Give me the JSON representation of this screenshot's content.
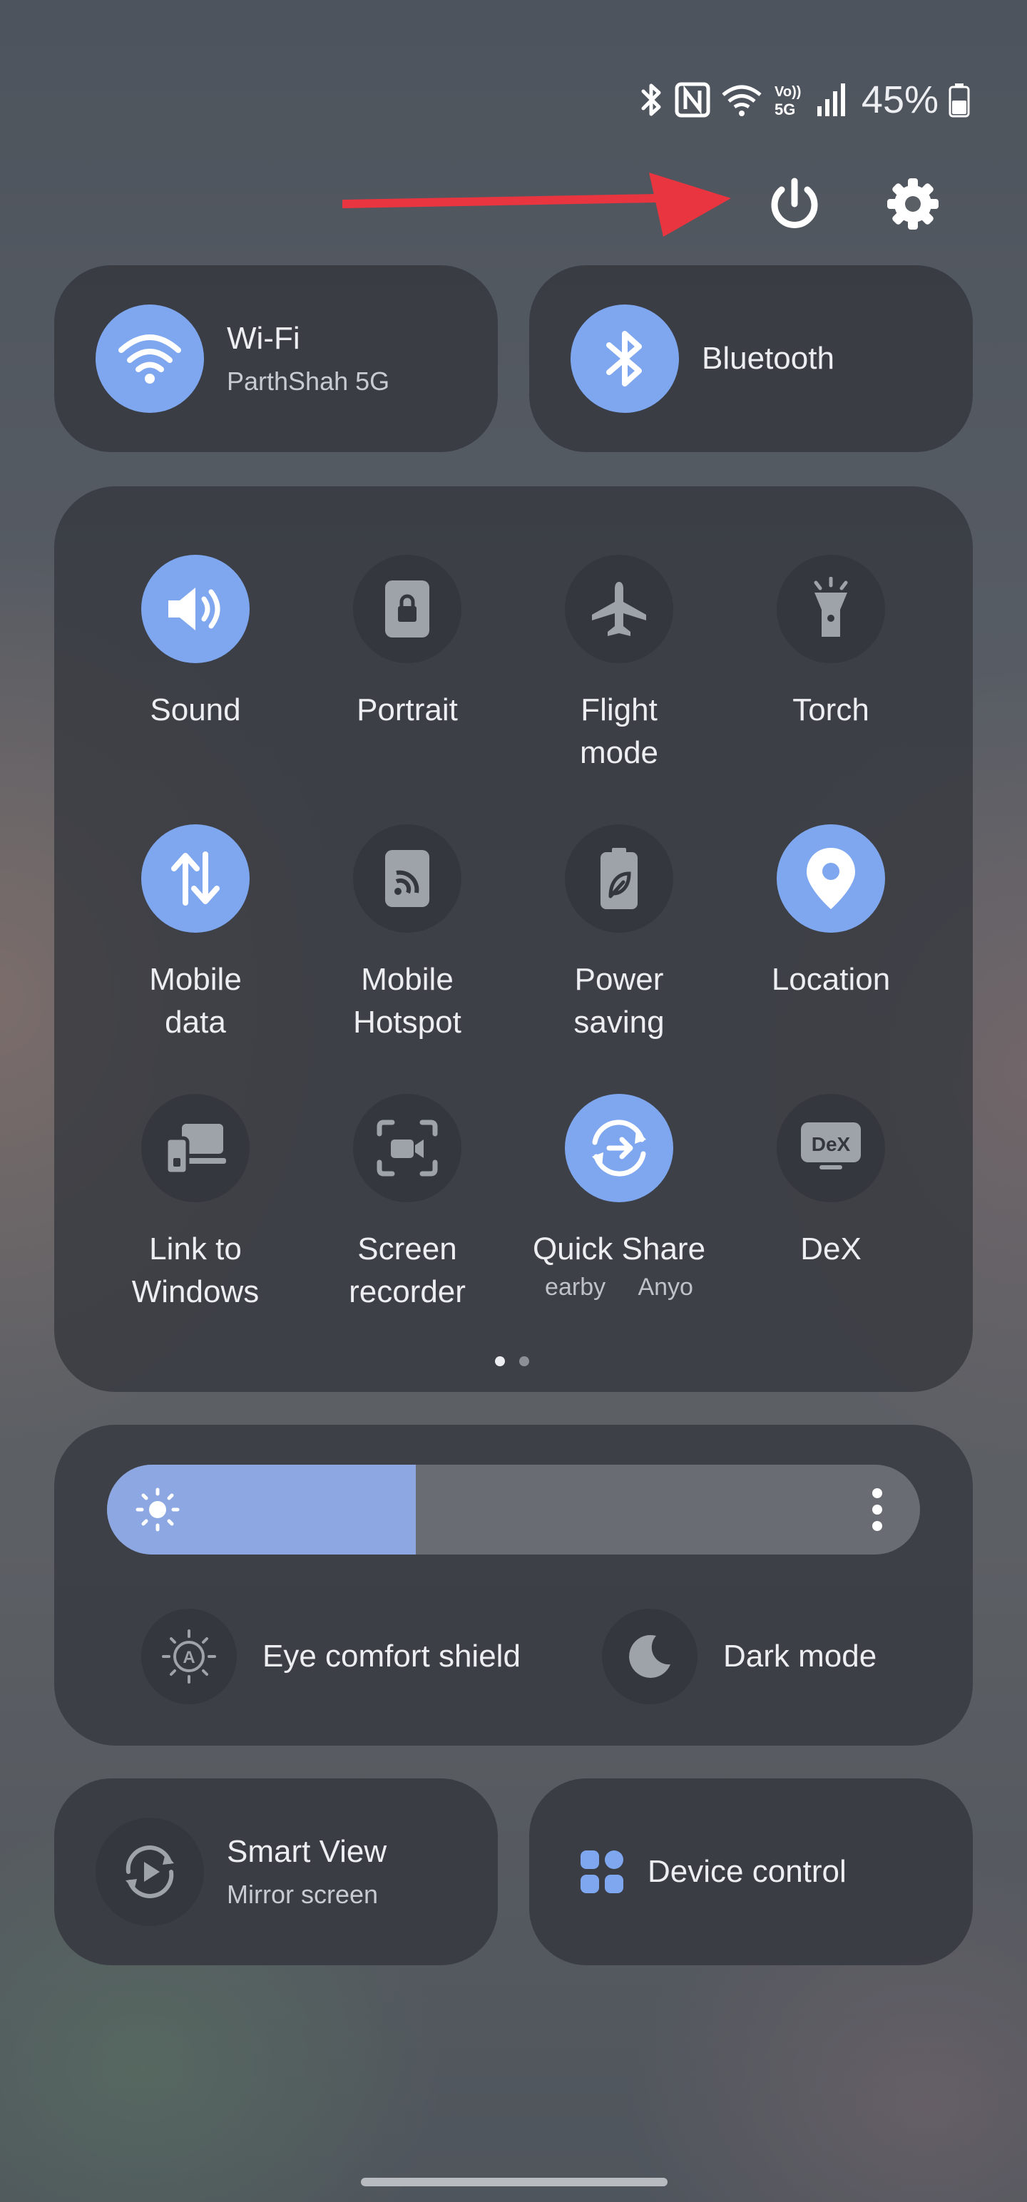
{
  "status_bar": {
    "battery_percent": "45%",
    "icons": [
      "bluetooth-icon",
      "nfc-icon",
      "wifi-icon",
      "volte-5g-icon",
      "signal-icon",
      "battery-icon"
    ]
  },
  "top_actions": {
    "annotation": "red-arrow",
    "power": "power-icon",
    "settings": "gear-icon"
  },
  "wifi": {
    "title": "Wi-Fi",
    "subtitle": "ParthShah 5G",
    "state": "on"
  },
  "bluetooth": {
    "title": "Bluetooth",
    "state": "on"
  },
  "tiles": [
    {
      "label": "Sound",
      "icon": "speaker-icon",
      "state": "on"
    },
    {
      "label": "Portrait",
      "icon": "portrait-lock-icon",
      "state": "off"
    },
    {
      "label": "Flight\nmode",
      "icon": "airplane-icon",
      "state": "off"
    },
    {
      "label": "Torch",
      "icon": "flashlight-icon",
      "state": "off"
    },
    {
      "label": "Mobile\ndata",
      "icon": "data-arrows-icon",
      "state": "on"
    },
    {
      "label": "Mobile\nHotspot",
      "icon": "hotspot-icon",
      "state": "off"
    },
    {
      "label": "Power\nsaving",
      "icon": "battery-leaf-icon",
      "state": "off"
    },
    {
      "label": "Location",
      "icon": "location-pin-icon",
      "state": "on"
    },
    {
      "label": "Link to\nWindows",
      "icon": "devices-icon",
      "state": "off"
    },
    {
      "label": "Screen\nrecorder",
      "icon": "screen-record-icon",
      "state": "off"
    },
    {
      "label": "Quick Share",
      "icon": "quick-share-icon",
      "state": "on",
      "marquee": "earby     Anyo"
    },
    {
      "label": "DeX",
      "icon": "dex-icon",
      "state": "off"
    }
  ],
  "page_indicator": {
    "pages": 2,
    "current": 1
  },
  "brightness": {
    "level": 0.38,
    "icon": "sun-icon",
    "menu": "more-vert-icon"
  },
  "eye_comfort": {
    "label": "Eye comfort shield"
  },
  "dark_mode": {
    "label": "Dark mode"
  },
  "smart_view": {
    "title": "Smart View",
    "subtitle": "Mirror screen"
  },
  "device_control": {
    "label": "Device control"
  },
  "colors": {
    "accent": "#7FA7EF",
    "tile_off": "#34373D",
    "panel": "#34373E",
    "arrow": "#E8353F"
  }
}
